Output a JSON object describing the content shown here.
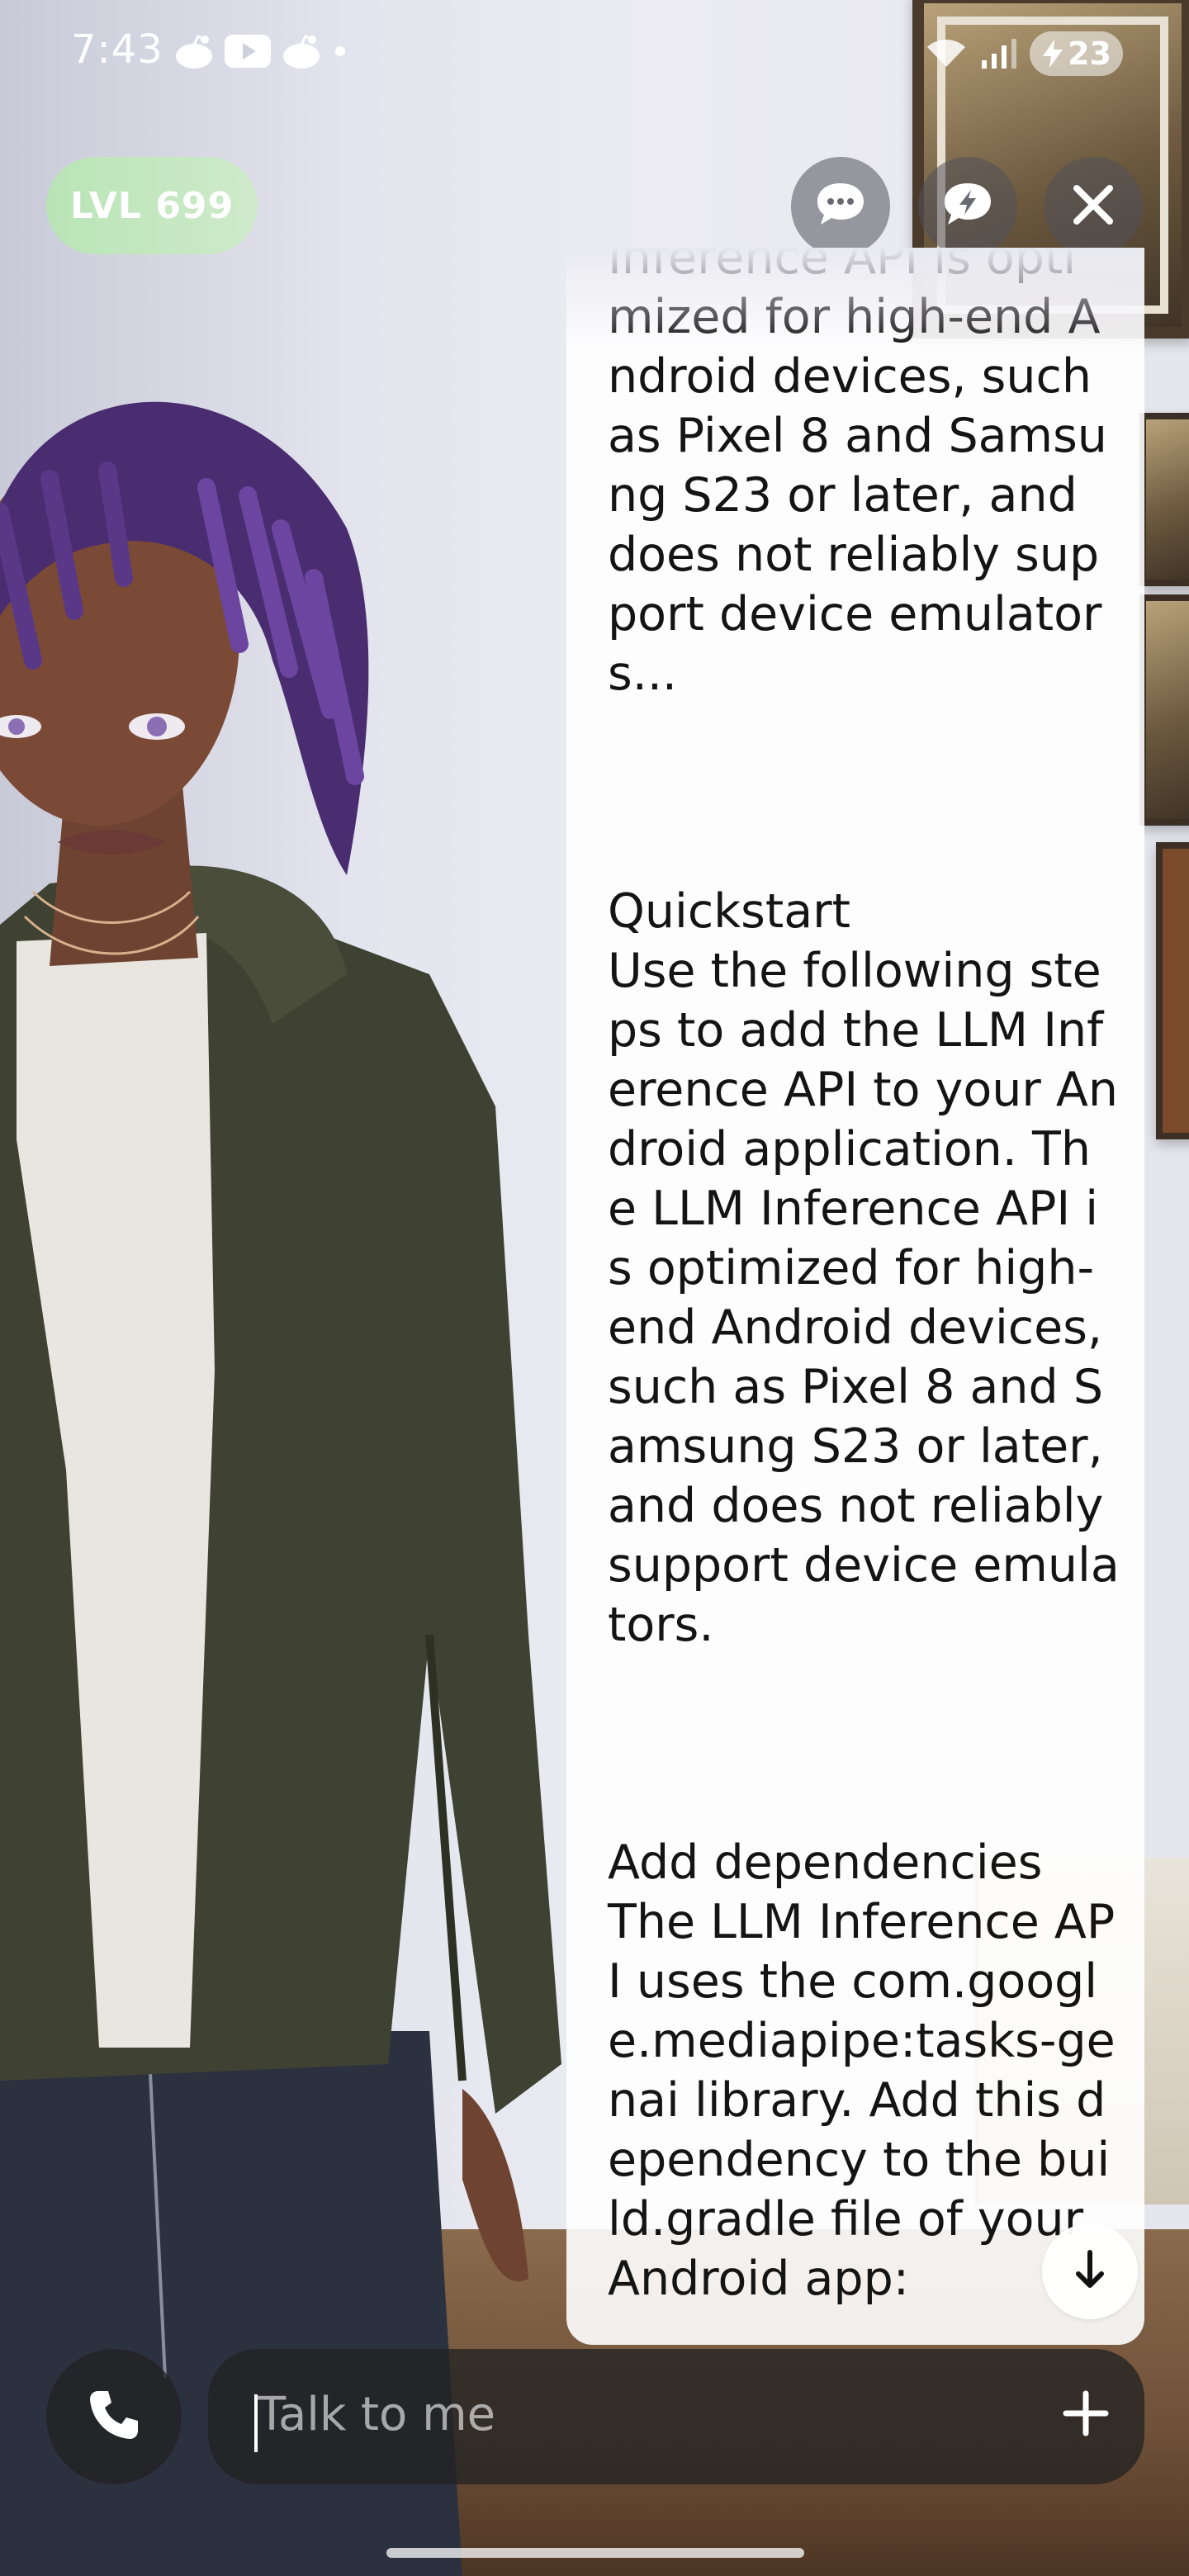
{
  "status_bar": {
    "time": "7:43",
    "battery_level": "23",
    "notification_icons": [
      "reddit-icon",
      "youtube-icon",
      "reddit-icon",
      "dot-icon"
    ],
    "system_icons": [
      "wifi-icon",
      "signal-icon",
      "battery-icon"
    ]
  },
  "top_bar": {
    "level_badge": "LVL 699",
    "buttons": [
      "chat-bubble-icon",
      "lightning-chat-icon",
      "close-icon"
    ]
  },
  "message": {
    "paragraphs": [
      "Inference API is optimized for high-end Android devices, such as Pixel 8 and Samsung S23 or later, and does not reliably support device emulators...",
      "Quickstart\nUse the following steps to add the LLM Inference API to your Android application. The LLM Inference API is optimized for high-end Android devices, such as Pixel 8 and Samsung S23 or later, and does not reliably support device emulators.",
      "Add dependencies\nThe LLM Inference API uses the com.google.mediapipe:tasks-genai library. Add this dependency to the build.gradle file of your Android app:"
    ]
  },
  "input": {
    "placeholder": "Talk to me",
    "value": ""
  },
  "colors": {
    "level_badge": "#c2e7bf",
    "input_bar": "#232323",
    "panel": "#ffffff",
    "text": "#141414"
  }
}
